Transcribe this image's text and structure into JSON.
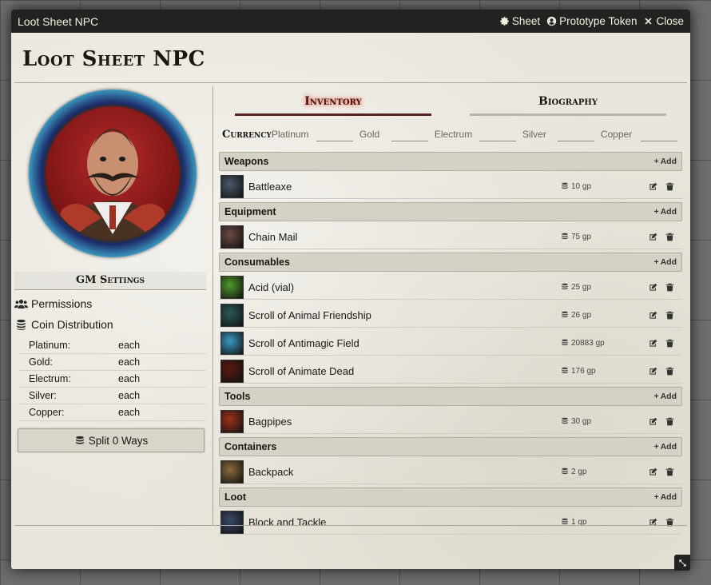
{
  "window": {
    "title": "Loot Sheet NPC",
    "buttons": {
      "sheet": "Sheet",
      "prototype_token": "Prototype Token",
      "close": "Close"
    }
  },
  "sheet": {
    "name": "Loot Sheet NPC"
  },
  "sidebar": {
    "gm_settings": "GM Settings",
    "permissions": "Permissions",
    "coin_distribution": "Coin Distribution",
    "coins": [
      {
        "label": "Platinum:",
        "value": "each"
      },
      {
        "label": "Gold:",
        "value": "each"
      },
      {
        "label": "Electrum:",
        "value": "each"
      },
      {
        "label": "Silver:",
        "value": "each"
      },
      {
        "label": "Copper:",
        "value": "each"
      }
    ],
    "split_button": "Split 0 Ways"
  },
  "tabs": [
    {
      "label": "Inventory",
      "active": true
    },
    {
      "label": "Biography",
      "active": false
    }
  ],
  "currency": {
    "label": "Currency",
    "items": [
      {
        "label": "Platinum",
        "value": ""
      },
      {
        "label": "Gold",
        "value": ""
      },
      {
        "label": "Electrum",
        "value": ""
      },
      {
        "label": "Silver",
        "value": ""
      },
      {
        "label": "Copper",
        "value": ""
      }
    ]
  },
  "add_label": "Add",
  "sections": [
    {
      "name": "Weapons",
      "items": [
        {
          "name": "Battleaxe",
          "price": "10 gp",
          "icon": "battleaxe-icon",
          "color": "#4b5a6a"
        }
      ]
    },
    {
      "name": "Equipment",
      "items": [
        {
          "name": "Chain Mail",
          "price": "75 gp",
          "icon": "chain-mail-icon",
          "color": "#6d4a44"
        }
      ]
    },
    {
      "name": "Consumables",
      "items": [
        {
          "name": "Acid (vial)",
          "price": "25 gp",
          "icon": "acid-vial-icon",
          "color": "#4f9a2a"
        },
        {
          "name": "Scroll of Animal Friendship",
          "price": "26 gp",
          "icon": "scroll-icon",
          "color": "#2a5a5a"
        },
        {
          "name": "Scroll of Antimagic Field",
          "price": "20883 gp",
          "icon": "scroll-icon",
          "color": "#3a9ac0"
        },
        {
          "name": "Scroll of Animate Dead",
          "price": "176 gp",
          "icon": "scroll-icon",
          "color": "#5a1a10"
        }
      ]
    },
    {
      "name": "Tools",
      "items": [
        {
          "name": "Bagpipes",
          "price": "30 gp",
          "icon": "bagpipes-icon",
          "color": "#a0321a"
        }
      ]
    },
    {
      "name": "Containers",
      "items": [
        {
          "name": "Backpack",
          "price": "2 gp",
          "icon": "backpack-icon",
          "color": "#8a6a3a"
        }
      ]
    },
    {
      "name": "Loot",
      "items": [
        {
          "name": "Block and Tackle",
          "price": "1 gp",
          "icon": "block-and-tackle-icon",
          "color": "#3a4a6a"
        }
      ]
    }
  ]
}
